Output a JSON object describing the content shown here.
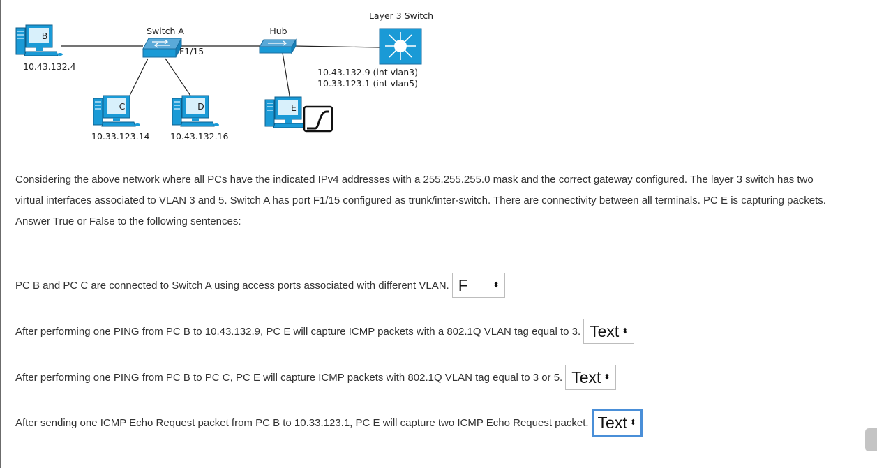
{
  "diagram": {
    "labels": {
      "layer3_switch": "Layer 3 Switch",
      "switch_a": "Switch A",
      "hub": "Hub",
      "port": "F1/15",
      "pc_b": "B",
      "pc_c": "C",
      "pc_d": "D",
      "pc_e": "E",
      "ip_b": "10.43.132.4",
      "ip_c": "10.33.123.14",
      "ip_d": "10.43.132.16",
      "l3_ip1": "10.43.132.9 (int vlan3)",
      "l3_ip2": "10.33.123.1 (int vlan5)"
    },
    "colors": {
      "device_blue": "#1a9ad6",
      "focus_blue": "#4a8fd8"
    }
  },
  "paragraph": {
    "line1": "Considering the above network where all PCs have the indicated IPv4 addresses with a 255.255.255.0 mask and the correct gateway configured. The layer 3 switch has two",
    "line2": "virtual interfaces associated to VLAN 3 and 5. Switch A has port F1/15 configured as trunk/inter-switch. There are connectivity between all terminals. PC E is capturing packets.",
    "line3": "Answer True or False to the following sentences:"
  },
  "questions": [
    {
      "text": "PC B and PC C are connected to Switch A using access ports associated with different VLAN.",
      "selected": "F"
    },
    {
      "text": "After performing one PING from PC B to 10.43.132.9, PC E will capture ICMP packets with a 802.1Q VLAN tag equal to 3.",
      "selected": "Text"
    },
    {
      "text": "After performing one PING from PC B to PC C, PC E will capture ICMP packets with 802.1Q VLAN tag equal to 3 or 5.",
      "selected": "Text"
    },
    {
      "text": "After sending one ICMP Echo Request packet from PC B to 10.33.123.1, PC E will capture two ICMP Echo Request packet.",
      "selected": "Text"
    }
  ],
  "select_arrow": "⬍"
}
